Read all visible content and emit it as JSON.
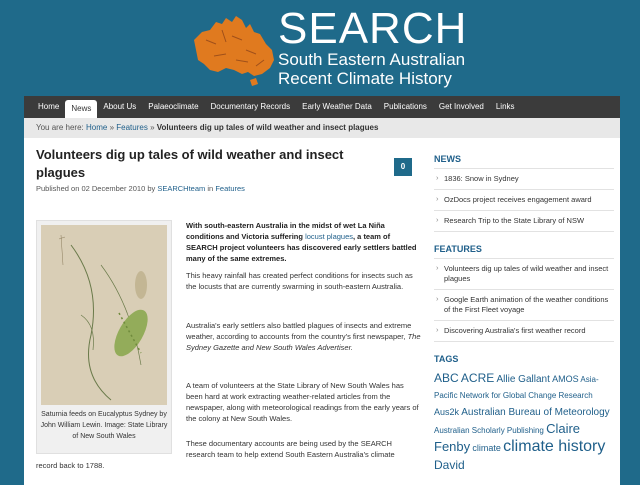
{
  "header": {
    "title": "SEARCH",
    "subtitle_line1": "South Eastern Australian",
    "subtitle_line2": "Recent Climate History"
  },
  "nav": {
    "items": [
      "Home",
      "News",
      "About Us",
      "Palaeoclimate",
      "Documentary Records",
      "Early Weather Data",
      "Publications",
      "Get Involved",
      "Links"
    ],
    "active_index": 1
  },
  "breadcrumb": {
    "prefix": "You are here:",
    "home": "Home",
    "sep": "»",
    "section": "Features",
    "current": "Volunteers dig up tales of wild weather and insect plagues"
  },
  "post": {
    "title": "Volunteers dig up tales of wild weather and insect plagues",
    "meta_prefix": "Published on 02 December 2010 by",
    "author": "SEARCHteam",
    "meta_in": "in",
    "category": "Features",
    "comments": "0",
    "figure_caption": "Saturnia feeds on Eucalyptus Sydney by John William Lewin. Image: State Library of New South Wales",
    "lede_start": "With south-eastern Australia in the midst of wet La Niña conditions and Victoria suffering",
    "lede_link": "locust plagues",
    "lede_end": ", a team of SEARCH project volunteers has discovered early settlers battled many of the same extremes.",
    "para1": "This heavy rainfall has created perfect conditions for insects such as the locusts that are currently swarming in south-eastern Australia.",
    "para2_start": "Australia's early settlers also battled plagues of insects and extreme weather, according to accounts from the country's first newspaper,",
    "para2_italic": "The Sydney Gazette and New South Wales Advertiser.",
    "para3": "A team of volunteers at the State Library of New South Wales has been hard at work extracting weather-related articles from the newspaper, along with meteorological readings from the early years of the colony at New South Wales.",
    "para4_a": "These documentary accounts are being used by the SEARCH research team to help extend South Eastern Australia's climate",
    "para4_b": "record back to 1788."
  },
  "sidebar": {
    "news_heading": "NEWS",
    "news": [
      "1836: Snow in Sydney",
      "OzDocs project receives engagement award",
      "Research Trip to the State Library of NSW"
    ],
    "features_heading": "FEATURES",
    "features": [
      "Volunteers dig up tales of wild weather and insect plagues",
      "Google Earth animation of the weather conditions of the First Fleet voyage",
      "Discovering Australia's first weather record"
    ],
    "tags_heading": "TAGS",
    "tags": [
      "ABC",
      "ACRE",
      "Allie Gallant",
      "AMOS",
      "Asia-Pacific Network for Global Change Research",
      "Aus2k",
      "Australian Bureau of Meteorology",
      "Australian Scholarly Publishing",
      "Claire Fenby",
      "climate",
      "climate history",
      "David"
    ]
  },
  "colors": {
    "brand_blue": "#1f6a8a",
    "nav_dark": "#3b3b3b",
    "logo_orange": "#e07a1f"
  }
}
